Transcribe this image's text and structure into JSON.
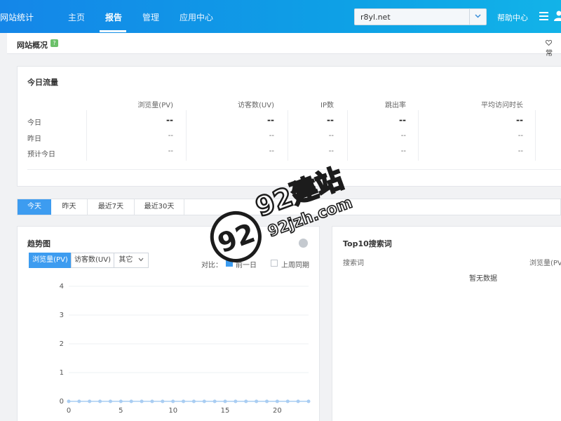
{
  "header": {
    "brand": "网站统计",
    "nav": [
      "主页",
      "报告",
      "管理",
      "应用中心"
    ],
    "site": "r8yl.net",
    "help": "帮助中心"
  },
  "subheader": {
    "title": "网站概况",
    "badge": "?",
    "fav": "常"
  },
  "traffic": {
    "title": "今日流量",
    "columns": [
      "浏览量(PV)",
      "访客数(UV)",
      "IP数",
      "跳出率",
      "平均访问时长"
    ],
    "rows": [
      {
        "label": "今日",
        "values": [
          "--",
          "--",
          "--",
          "--",
          "--"
        ]
      },
      {
        "label": "昨日",
        "values": [
          "--",
          "--",
          "--",
          "--",
          "--"
        ]
      },
      {
        "label": "预计今日",
        "values": [
          "--",
          "--",
          "--",
          "--",
          "--"
        ]
      }
    ]
  },
  "range_tabs": [
    "今天",
    "昨天",
    "最近7天",
    "最近30天"
  ],
  "trend": {
    "title": "趋势图",
    "segments": [
      "浏览量(PV)",
      "访客数(UV)",
      "其它"
    ],
    "compare_label": "对比：",
    "compare_options": [
      "前一日",
      "上周同期"
    ]
  },
  "top10": {
    "title": "Top10搜索词",
    "columns": [
      "搜索词",
      "浏览量(PV)"
    ],
    "empty": "暂无数据"
  },
  "watermark": {
    "text": "92建站",
    "url": "92jzh.com",
    "logo": "92"
  },
  "colors": {
    "nav": "#1486e8",
    "accent": "#3d9cf0",
    "series": "#a9cdf2"
  },
  "chart_data": {
    "type": "line",
    "x": [
      0,
      1,
      2,
      3,
      4,
      5,
      6,
      7,
      8,
      9,
      10,
      11,
      12,
      13,
      14,
      15,
      16,
      17,
      18,
      19,
      20,
      21,
      22,
      23
    ],
    "series": [
      {
        "values": [
          0,
          0,
          0,
          0,
          0,
          0,
          0,
          0,
          0,
          0,
          0,
          0,
          0,
          0,
          0,
          0,
          0,
          0,
          0,
          0,
          0,
          0,
          0,
          0
        ]
      }
    ],
    "xticks": [
      0,
      5,
      10,
      15,
      20
    ],
    "yticks": [
      0,
      1,
      2,
      3,
      4
    ],
    "ylim": [
      0,
      4
    ],
    "xlim": [
      0,
      23
    ],
    "grid": true
  }
}
